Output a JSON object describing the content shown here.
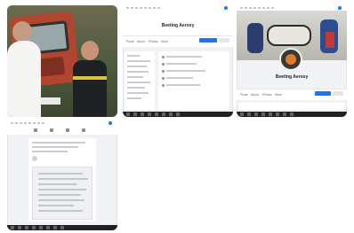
{
  "gallery": {
    "tiles": [
      {
        "kind": "photo"
      },
      {
        "kind": "screenshot",
        "page_title": "Beeting Aerosy",
        "tabs": [
          "Posts",
          "About",
          "Photos",
          "More"
        ]
      },
      {
        "kind": "screenshot",
        "page_title": "Beeting Aerosy",
        "tabs": [
          "Posts",
          "About",
          "Photos",
          "More"
        ]
      },
      {
        "kind": "screenshot"
      }
    ]
  },
  "colors": {
    "facebook_blue": "#1877f2",
    "page_bg": "#f0f2f5"
  }
}
